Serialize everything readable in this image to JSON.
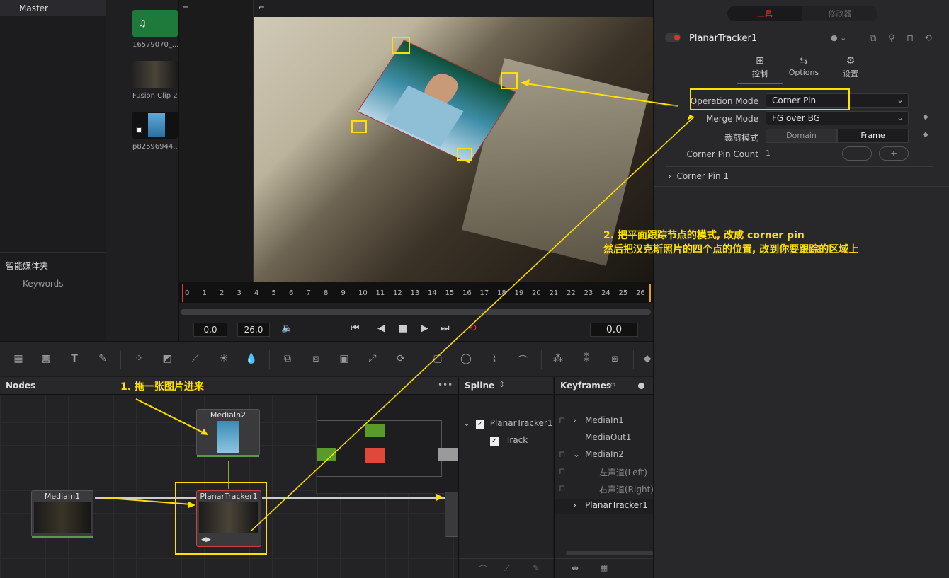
{
  "media_pool": {
    "master_bin": "Master",
    "smart_bins_title": "智能媒体夹",
    "keywords": "Keywords",
    "clips": [
      {
        "name": "16579070_..."
      },
      {
        "name": "Fusion Clip 2"
      },
      {
        "name": "p82596944..."
      }
    ]
  },
  "viewer": {
    "ruler_ticks": [
      "0",
      "1",
      "2",
      "3",
      "4",
      "5",
      "6",
      "7",
      "8",
      "9",
      "10",
      "11",
      "12",
      "13",
      "14",
      "15",
      "16",
      "17",
      "18",
      "19",
      "20",
      "21",
      "22",
      "23",
      "24",
      "25",
      "26"
    ],
    "start_time": "0.0",
    "end_time": "26.0",
    "current_time": "0.0"
  },
  "nodes_panel": {
    "title": "Nodes",
    "more": "•••",
    "nodes": {
      "mediain2": "MediaIn2",
      "mediain1": "MediaIn1",
      "planar": "PlanarTracker1"
    }
  },
  "spline_panel": {
    "title": "Spline",
    "tree_root": "PlanarTracker1",
    "tree_child": "Track"
  },
  "keyframes_panel": {
    "title": "Keyframes",
    "items": [
      "MediaIn1",
      "MediaOut1",
      "MediaIn2",
      "左声道(Left)",
      "右声道(Right)",
      "PlanarTracker1"
    ]
  },
  "inspector": {
    "tab_tools": "工具",
    "tab_modifiers": "修改器",
    "node_name": "PlanarTracker1",
    "subtabs": [
      "控制",
      "Options",
      "设置"
    ],
    "operation_mode_label": "Operation Mode",
    "operation_mode_value": "Corner Pin",
    "merge_mode_label": "Merge Mode",
    "merge_mode_value": "FG over BG",
    "crop_mode_label": "裁剪模式",
    "crop_options": [
      "Domain",
      "Frame"
    ],
    "corner_count_label": "Corner Pin Count",
    "corner_count_value": "1",
    "minus": "-",
    "plus": "+",
    "corner_pin_section": "Corner Pin 1"
  },
  "annotations": {
    "step1": "1. 拖一张图片进来",
    "step2_line1": "2. 把平面跟踪节点的模式, 改成 corner pin",
    "step2_line2": "然后把汉克斯照片的四个点的位置, 改到你要跟踪的区域上"
  },
  "colors": {
    "annotation": "#ffe200",
    "accent_red": "#e0322a",
    "node_green": "#5a9a4a"
  }
}
